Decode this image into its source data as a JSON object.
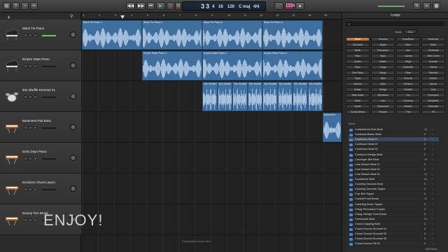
{
  "toolbar": {
    "lcd_bar": "3",
    "lcd_beat": "3",
    "lcd_div": "4",
    "lcd_tick": "16",
    "lcd_tempo": "120",
    "lcd_key": "C maj",
    "lcd_sig": "4/4",
    "loops_title": "Loops",
    "scale_label": "Scale",
    "scale_value": "Any"
  },
  "ruler": [
    "1",
    "2",
    "3",
    "4",
    "5",
    "6",
    "7",
    "8",
    "9",
    "10",
    "11",
    "12",
    "13",
    "14",
    "15",
    "16"
  ],
  "tracks": [
    {
      "name": "Black Tie Piano",
      "icon": "grand-piano-icon"
    },
    {
      "name": "Empire State Piano",
      "icon": "grand-piano-icon"
    },
    {
      "name": "90s Shuffle Drumset 01",
      "icon": "drum-kit-icon"
    },
    {
      "name": "Basement Pad Bass",
      "icon": "keyboard-icon"
    },
    {
      "name": "Early Days Piano",
      "icon": "keyboard-icon"
    },
    {
      "name": "Evolution Chord Layers",
      "icon": "keyboard-icon"
    },
    {
      "name": "Boomy Tom Break",
      "icon": "keyboard-icon"
    }
  ],
  "regions": [
    {
      "lane": 0,
      "labels": [
        "Black Tie Piano.1",
        "Black Tie Piano.2",
        "Black Tie Piano.3",
        "Black Tie Piano.4"
      ]
    },
    {
      "lane": 1,
      "labels": [
        "Empire State Piano.1",
        "Empire State Piano.2",
        "Empire State Piano.3"
      ]
    },
    {
      "lane": 2,
      "labels": [
        "90s Shuffle Drumset",
        "90s Shuffle Drumset",
        "90s Shuffle Drumset",
        "90s Shuffle Drumset",
        "90s Shuffle Drumset",
        "90s Shuffle Drumset",
        "90s Shuffle Drumset",
        "90s Shuffle Drumset"
      ]
    },
    {
      "lane": 3,
      "labels": [
        "Basement"
      ]
    }
  ],
  "drop_hint": "Drag Apple Loops here.",
  "overlay_text": "ENJOY!",
  "keywords": [
    [
      "Reset",
      "Favorites",
      "Rock/Blues",
      "Electronic"
    ],
    [
      "All Drums",
      "Jingles",
      "Other",
      "World"
    ],
    [
      "Beats",
      "Percussion",
      "Jazz",
      "Orchestral"
    ],
    [
      "Piano",
      "Bass",
      "Country",
      "Other Genre"
    ],
    [
      "Synths",
      "Shaker",
      "Single",
      "Acoustic"
    ],
    [
      "Piano",
      "Conga",
      "Ensemble",
      "Electric"
    ],
    [
      "Elec Piano",
      "Bongo",
      "Clean",
      "Distorted"
    ],
    [
      "Organ",
      "Tabla",
      "Acoustic",
      "Electric"
    ],
    [
      "Clavinet",
      "Vibes",
      "Relaxed",
      "Intense"
    ],
    [
      "Guitars",
      "Strings",
      "Cheerful",
      "Dark"
    ],
    [
      "Slide Guitar",
      "Woodwind",
      "Dry",
      "Processed"
    ],
    [
      "Brass",
      "Horn",
      "Grooving",
      "Arrhythmic"
    ],
    [
      "Vocals",
      "Saxophone",
      "Melodic",
      "Dissonant"
    ],
    [
      "Sound Effects",
      "Textures",
      "Part",
      "Fill"
    ]
  ],
  "list": {
    "header": "Name",
    "rows": [
      {
        "name": "Contentment Tech Beat",
        "beats": "16"
      },
      {
        "name": "Continual Motion Beat",
        "beats": "8"
      },
      {
        "name": "Continuum Beat 01",
        "beats": "8"
      },
      {
        "name": "Continuum Beat 02",
        "beats": "8"
      },
      {
        "name": "Continuum Beat 03",
        "beats": "8"
      },
      {
        "name": "Contoured Design Beat",
        "beats": "8"
      },
      {
        "name": "Converger Bell Beat",
        "beats": "16"
      },
      {
        "name": "Core Breach Beat 01",
        "beats": "8"
      },
      {
        "name": "Core Breach Beat 02",
        "beats": "8"
      },
      {
        "name": "Core Breach Beat 03",
        "beats": "16"
      },
      {
        "name": "Countdown Beat",
        "beats": "32"
      },
      {
        "name": "Counting Seconds Beat",
        "beats": "8"
      },
      {
        "name": "Counting Seconds Topper",
        "beats": "8"
      },
      {
        "name": "Cow Bell Topper",
        "beats": "8"
      },
      {
        "name": "Cowbell Funk Break",
        "beats": "32"
      },
      {
        "name": "Crackling Snare Topper",
        "beats": "8"
      },
      {
        "name": "Crispy Percussion Topper",
        "beats": "8"
      },
      {
        "name": "Crispy Vintage Funk Break",
        "beats": "8"
      },
      {
        "name": "Crossroads Beat",
        "beats": "32"
      },
      {
        "name": "Crowd Clapping Beat",
        "beats": "8"
      },
      {
        "name": "Crowd Groove Drumset 01",
        "beats": "8"
      },
      {
        "name": "Crowd Groove Drumset 02",
        "beats": "8"
      },
      {
        "name": "Crowd Groove Drumset 06",
        "beats": "8"
      },
      {
        "name": "Crowd Groove Fill 06",
        "beats": "8"
      }
    ],
    "count": "1080 items"
  },
  "colors": {
    "region": "#3f6f9e",
    "accent": "#c07b3c",
    "play": "#3fa63f"
  }
}
